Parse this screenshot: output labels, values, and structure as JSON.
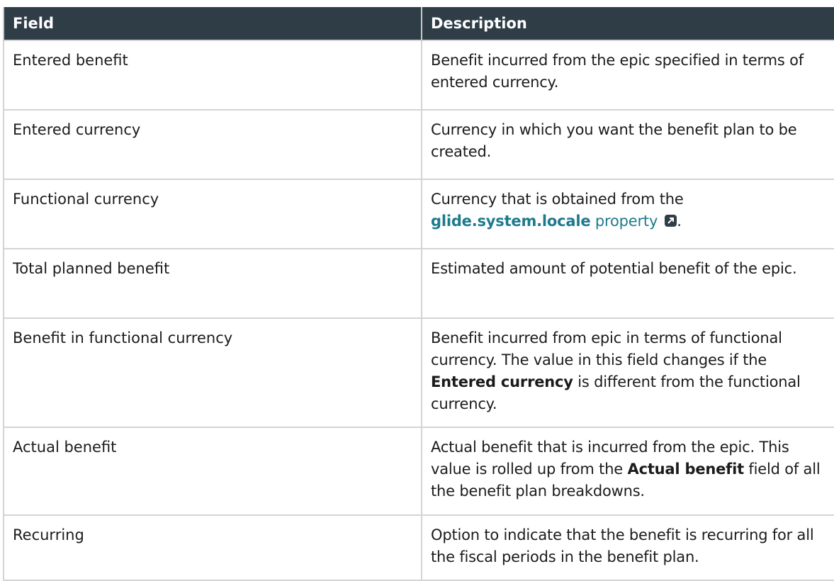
{
  "table": {
    "headers": {
      "field": "Field",
      "description": "Description"
    },
    "rows": [
      {
        "field": "Entered benefit",
        "desc": {
          "text": "Benefit incurred from the epic specified in terms of entered currency."
        }
      },
      {
        "field": "Entered currency",
        "desc": {
          "text": "Currency in which you want the benefit plan to be created."
        }
      },
      {
        "field": "Functional currency",
        "desc": {
          "pre": "Currency that is obtained from the",
          "link_bold": "glide.system.locale",
          "link_rest": "property",
          "post": ".",
          "icon": "external-link-icon"
        }
      },
      {
        "field": "Total planned benefit",
        "desc": {
          "text": "Estimated amount of potential benefit of the epic."
        }
      },
      {
        "field": "Benefit in functional currency",
        "desc": {
          "pre": "Benefit incurred from epic in terms of functional currency. The value in this field changes if the",
          "bold": "Entered currency",
          "post": "is different from the functional currency."
        }
      },
      {
        "field": "Actual benefit",
        "desc": {
          "pre": "Actual benefit that is incurred from the epic. This value is rolled up from the",
          "bold": "Actual benefit",
          "post": "field of all the benefit plan breakdowns."
        }
      },
      {
        "field": "Recurring",
        "desc": {
          "text": "Option to indicate that the benefit is recurring for all the fiscal periods in the benefit plan."
        }
      }
    ]
  }
}
